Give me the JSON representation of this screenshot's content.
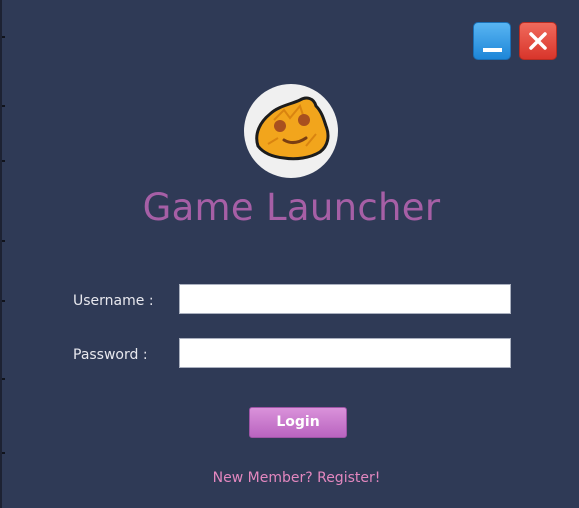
{
  "window": {
    "title": "Game Launcher",
    "controls": {
      "minimize_icon": "minimize-icon",
      "close_icon": "close-icon"
    }
  },
  "logo": {
    "icon": "cheese-chip-mascot-icon"
  },
  "form": {
    "username_label": "Username :",
    "username_value": "",
    "password_label": "Password :",
    "password_value": "",
    "login_label": "Login"
  },
  "register_link": "New Member? Register!",
  "colors": {
    "background": "#2f3a56",
    "title": "#a65fa6",
    "button": "#c77bcb",
    "link": "#e387bf",
    "minimize": "#2a93e0",
    "close": "#e0443a"
  }
}
